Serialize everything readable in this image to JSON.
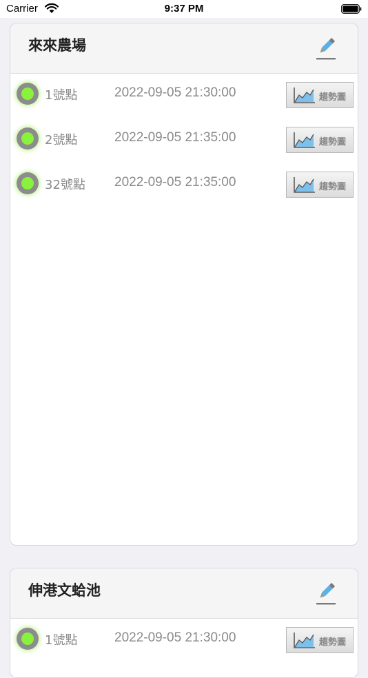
{
  "status_bar": {
    "carrier": "Carrier",
    "time": "9:37 PM"
  },
  "farms": [
    {
      "name": "來來農場",
      "points": [
        {
          "name": "1號點",
          "time": "2022-09-05 21:30:00",
          "trend_label": "趨勢圖",
          "status_color": "#88f23c"
        },
        {
          "name": "2號點",
          "time": "2022-09-05 21:35:00",
          "trend_label": "趨勢圖",
          "status_color": "#88f23c"
        },
        {
          "name": "32號點",
          "time": "2022-09-05 21:35:00",
          "trend_label": "趨勢圖",
          "status_color": "#88f23c"
        }
      ]
    },
    {
      "name": "伸港文蛤池",
      "points": [
        {
          "name": "1號點",
          "time": "2022-09-05 21:30:00",
          "trend_label": "趨勢圖",
          "status_color": "#88f23c"
        }
      ]
    }
  ],
  "colors": {
    "status_online": "#88f23c",
    "background": "#f0f0f5"
  }
}
